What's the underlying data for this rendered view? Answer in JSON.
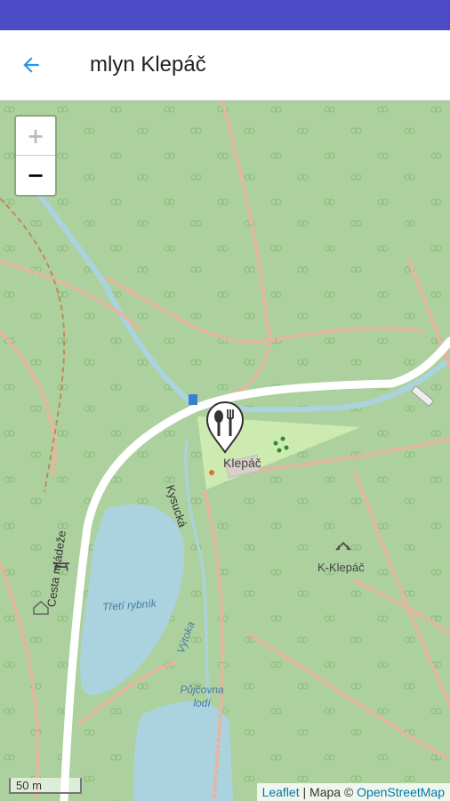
{
  "app": {
    "title": "mlyn Klepáč"
  },
  "map": {
    "zoom_in": "+",
    "zoom_out": "−",
    "scale": "50 m",
    "attribution": {
      "leaflet": "Leaflet",
      "sep1": " | Mapa © ",
      "osm": "OpenStreetMap"
    },
    "labels": {
      "road_main": "Cesta mládeže",
      "road_kysucka": "Kysucká",
      "poi_klepac": "Klepáč",
      "poi_kklepac": "K-Klepáč",
      "pond1": "Třetí rybník",
      "pond2": "Půjčovna lodí",
      "stream": "Výtoka"
    },
    "marker_icon": "restaurant-icon"
  }
}
